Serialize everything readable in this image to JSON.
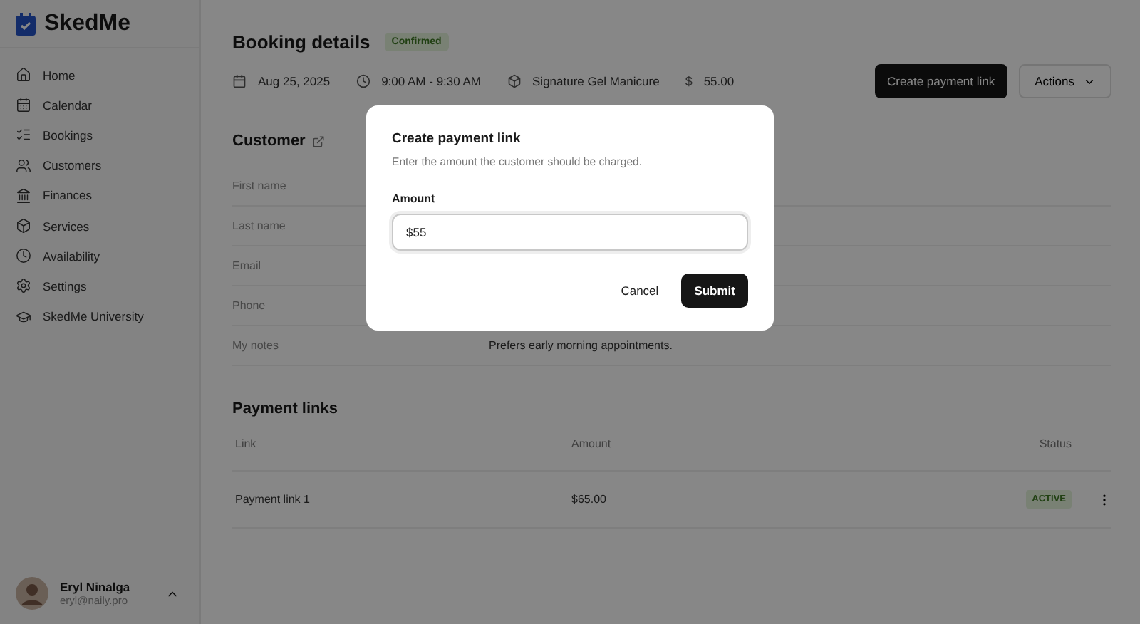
{
  "sidebar": {
    "brand": "SkedMe",
    "items": [
      {
        "label": "Home",
        "selected": false
      },
      {
        "label": "Calendar",
        "selected": false
      },
      {
        "label": "Bookings",
        "selected": false
      },
      {
        "label": "Customers",
        "selected": false
      },
      {
        "label": "Finances",
        "selected": false
      },
      {
        "label": "Services",
        "selected": false
      },
      {
        "label": "Availability",
        "selected": false
      },
      {
        "label": "Settings",
        "selected": false
      },
      {
        "label": "SkedMe University",
        "selected": false
      }
    ],
    "user": {
      "name": "Eryl Ninalga",
      "email": "eryl@naily.pro"
    }
  },
  "header": {
    "title": "Booking details",
    "status": "Confirmed",
    "date": "Aug 25, 2025",
    "time": "9:00 AM - 9:30 AM",
    "service": "Signature Gel Manicure",
    "price": "55.00",
    "price_symbol": "$",
    "primary_button": "Create payment link",
    "actions_button": "Actions"
  },
  "customer": {
    "title": "Customer",
    "fields": [
      {
        "label": "First name"
      },
      {
        "label": "Last name"
      },
      {
        "label": "Email"
      },
      {
        "label": "Phone"
      },
      {
        "label": "My notes",
        "value": "Prefers early morning appointments."
      }
    ]
  },
  "payment_links": {
    "title": "Payment links",
    "columns": [
      "Link",
      "Amount",
      "Status"
    ],
    "rows": [
      {
        "link": "Payment link 1",
        "amount": "$65.00",
        "status": "ACTIVE"
      }
    ]
  },
  "dialog": {
    "title": "Create payment link",
    "description": "Enter the amount the customer should be charged.",
    "field_label": "Amount",
    "value": "$55",
    "cancel": "Cancel",
    "submit": "Submit"
  }
}
